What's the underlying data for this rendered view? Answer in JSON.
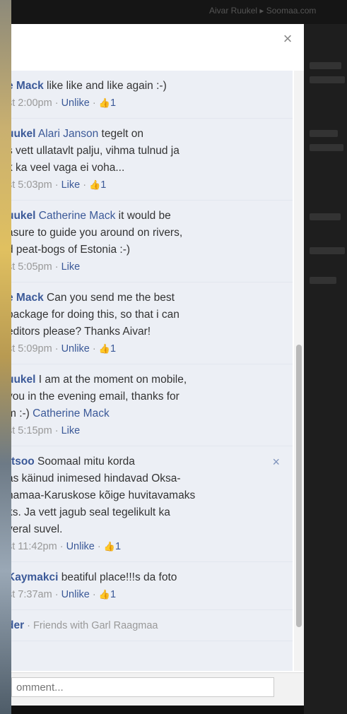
{
  "background": {
    "top_text": "Aivar Ruukel ▸ Soomaa.com"
  },
  "viewer": {
    "close_icon": "×",
    "comment_placeholder": "omment..."
  },
  "comments": [
    {
      "author": "e Mack",
      "text": " like like and like again :-)",
      "time": "st 2:00pm",
      "action": "Unlike",
      "likes": "1"
    },
    {
      "author": "uukel",
      "tag": " Alari Janson",
      "text_lines": [
        " tegelt on",
        "s vett ullatavlt palju, vihma tulnud ja",
        "k ka veel vaga ei voha..."
      ],
      "time": "st 5:03pm",
      "action": "Like",
      "likes": "1"
    },
    {
      "author": "uukel",
      "tag": " Catherine Mack",
      "text_lines": [
        " it would be",
        "asure to guide you around on rivers,",
        "d peat-bogs of Estonia :-)"
      ],
      "time": "st 5:05pm",
      "action": "Like"
    },
    {
      "author": "e Mack",
      "text_lines": [
        " Can you send me the best",
        "package for doing this, so that i can",
        "editors please? Thanks Aivar!"
      ],
      "time": "st 5:09pm",
      "action": "Unlike",
      "likes": "1"
    },
    {
      "author": "uukel",
      "text_lines": [
        " I am at the moment on mobile,",
        "you in the evening email, thanks for",
        "m :-) "
      ],
      "tag_end": "Catherine Mack",
      "time": "st 5:15pm",
      "action": "Like"
    },
    {
      "author": "rtsoo",
      "text_lines": [
        " Soomaal mitu korda",
        "as käinud inimesed hindavad Oksa-",
        "namaa-Karuskose kõige huvitavamaks",
        "ks. Ja vett jagub seal tegelikult ka",
        "veral suvel."
      ],
      "time": "st 11:42pm",
      "action": "Unlike",
      "likes": "1",
      "x_icon": "×"
    },
    {
      "author": "Kaymakci",
      "text": " beatiful place!!!s da foto",
      "time": "st 7:37am",
      "action": "Unlike",
      "likes": "1"
    },
    {
      "author": "der",
      "text": " · Friends with Garl Raagmaa"
    }
  ],
  "labels": {
    "sep": " · ",
    "like_icon": "👍"
  }
}
